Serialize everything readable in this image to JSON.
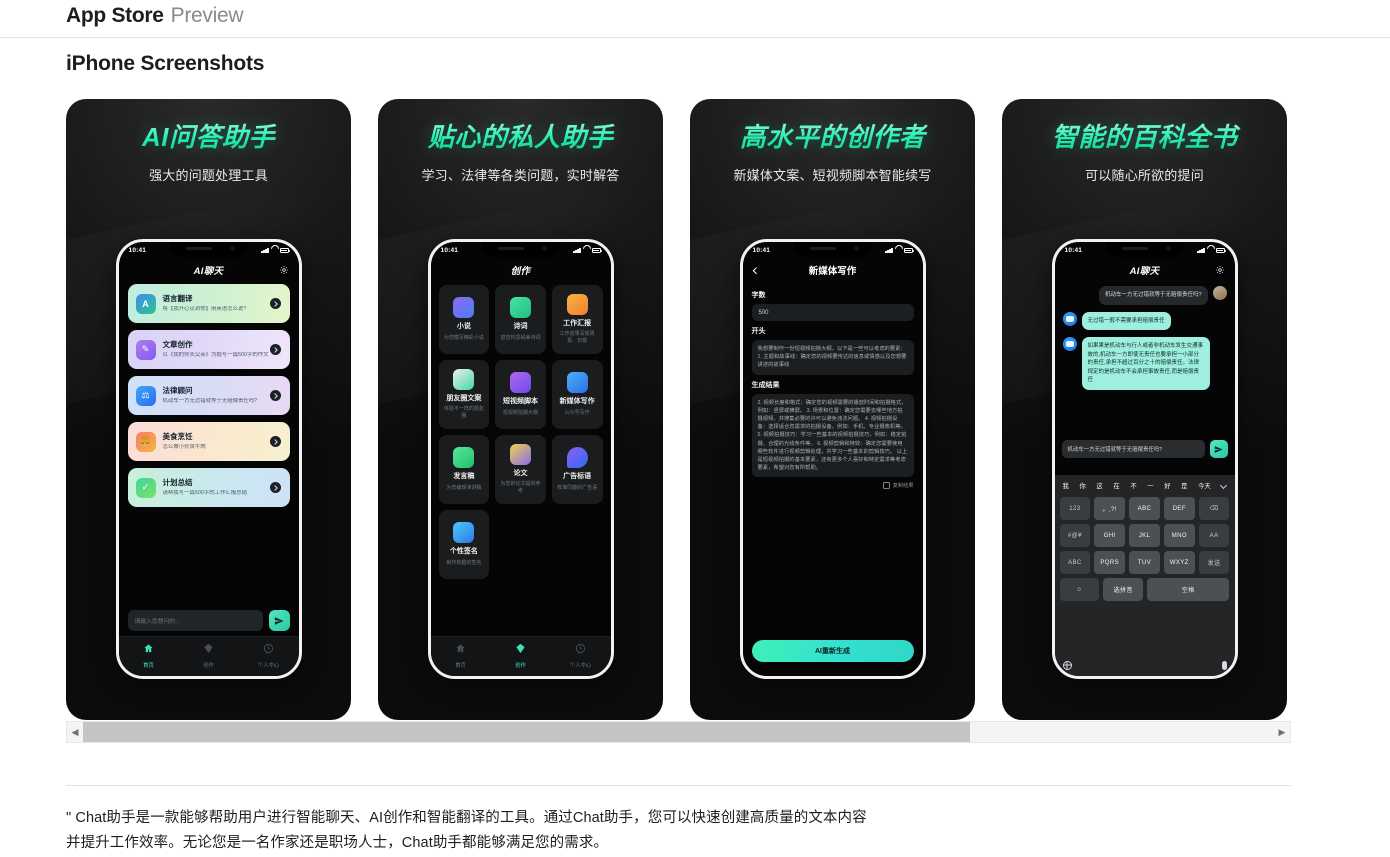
{
  "header": {
    "brand_bold": "App Store",
    "brand_light": "Preview"
  },
  "section": {
    "title": "iPhone Screenshots"
  },
  "scrollbar": {
    "left_arrow": "◀",
    "right_arrow": "▶",
    "thumb_percent": 74.5
  },
  "description": "\" Chat助手是一款能够帮助用户进行智能聊天、AI创作和智能翻译的工具。通过Chat助手，您可以快速创建高质量的文本内容并提升工作效率。无论您是一名作家还是职场人士，Chat助手都能够满足您的需求。",
  "colors": {
    "accent_green": "#2ff0b4",
    "bubble_bot": "#9fefe0",
    "panel_dark": "#1a1c1e",
    "page_bg": "#ffffff"
  },
  "status_bar": {
    "time": "10:41"
  },
  "shots": [
    {
      "title": "AI问答助手",
      "subtitle": "强大的问题处理工具",
      "nav_title": "AI聊天",
      "cards": [
        {
          "title": "语言翻译",
          "desc": "将【我开心见到你】用英语怎么说?"
        },
        {
          "title": "文章创作",
          "desc": "以《我的师长父亲》为题写一篇500字的作文"
        },
        {
          "title": "法律顾问",
          "desc": "机动车一方无过错就等于无赔偿责任吗?"
        },
        {
          "title": "美食烹饪",
          "desc": "怎么做小炒黄牛肉"
        },
        {
          "title": "计划总结",
          "desc": "请帮我写一篇500字的工作汇报总结"
        }
      ],
      "input_placeholder": "请输入您想问的...",
      "tabs": [
        {
          "label": "首页",
          "icon": "home-icon",
          "active": true
        },
        {
          "label": "创作",
          "icon": "create-icon",
          "active": false
        },
        {
          "label": "个人中心",
          "icon": "profile-icon",
          "active": false
        }
      ]
    },
    {
      "title": "贴心的私人助手",
      "subtitle": "学习、法律等各类问题，实时解答",
      "nav_title": "创作",
      "grid": [
        {
          "title": "小说",
          "desc": "为您模写精彩小说",
          "icon": "book-icon",
          "color": "#7b5cf0"
        },
        {
          "title": "诗词",
          "desc": "替您构思绢美诗词",
          "icon": "poem-icon",
          "color": "#2fc48a"
        },
        {
          "title": "工作汇报",
          "desc": "工作成果写成周报、日报",
          "icon": "report-icon",
          "color": "#f4a33f"
        },
        {
          "title": "朋友圈文案",
          "desc": "体验不一样的朋友圈",
          "icon": "moments-icon",
          "color": "#2fc48a"
        },
        {
          "title": "短视频脚本",
          "desc": "短视频拍摄大纲",
          "icon": "video-icon",
          "color": "#9b5cf0"
        },
        {
          "title": "新媒体写作",
          "desc": "公众号写作",
          "icon": "media-icon",
          "color": "#2f8cf0"
        },
        {
          "title": "发言稿",
          "desc": "为您编辑演讲稿",
          "icon": "speech-icon",
          "color": "#3fd68a"
        },
        {
          "title": "论文",
          "desc": "为您的论文提供参考",
          "icon": "thesis-icon",
          "color": "#7b5cf0"
        },
        {
          "title": "广告标语",
          "desc": "校准同趣的广告语",
          "icon": "ad-icon",
          "color": "#3f6df0"
        },
        {
          "title": "个性签名",
          "desc": "制作有趣的签名",
          "icon": "signature-icon",
          "color": "#2f9cf0"
        }
      ],
      "tabs": [
        {
          "label": "首页",
          "icon": "home-icon",
          "active": false
        },
        {
          "label": "创作",
          "icon": "create-icon",
          "active": true
        },
        {
          "label": "个人中心",
          "icon": "profile-icon",
          "active": false
        }
      ]
    },
    {
      "title": "高水平的创作者",
      "subtitle": "新媒体文案、短视频脚本智能续写",
      "nav_title": "新媒体写作",
      "form": {
        "word_count_label": "字数",
        "word_count_value": "500",
        "opening_label": "开头",
        "opening_text": "我想要制作一份短视频拍摄大纲，以下是一些可以考虑的要素：\n1. 主题和故事线：确定您的视频要传达的信息或情感以及您想要讲述的故事线",
        "result_label": "生成结果",
        "result_text": "2. 视频长度和格式：确定您的视频需要的播放时间和拍摄格式，例如：竖屏或横屏。\n3. 场景和位置：确定您需要去哪些地方拍摄视频，并搜集必要的许可以避免违法问题。\n4. 视频拍摄设备：选择适合您需求的拍摄设备，例如：手机、专业摄像机等。\n5. 视频拍摄技巧：学习一些基本的视频拍摄技巧，例如：稳定拍摄、合理的光线条件等。\n6. 视频剪辑和特效：确定您需要使用哪些软件进行视频剪辑处理，并学习一些基本的剪辑技巧。\n以上是短视频拍摄的基本要素，还有更多个人喜好和特定需求等考虑要素，希望对您有所帮助。",
        "copy_label": "复制结果",
        "regenerate_label": "AI重新生成"
      }
    },
    {
      "title": "智能的百科全书",
      "subtitle": "可以随心所欲的提问",
      "nav_title": "AI聊天",
      "messages": [
        {
          "from": "user",
          "text": "机动车一方无过错就等于无赔偿责任吗?"
        },
        {
          "from": "bot",
          "text": "无过错一般不需要承担赔偿责任"
        },
        {
          "from": "bot",
          "text": "如果果是机动车与行人或者非机动车发生交通事故的,机动车一方即使无责任也要承担一小部分的责任,承担不超过百分之十的赔偿责任。法律规定的是机动车不会承担事故责任,而是赔偿责任"
        }
      ],
      "chat_input_value": "机动车一方无过错就等于无赔偿责任吗?",
      "keyboard": {
        "suggestions": [
          "我",
          "你",
          "这",
          "在",
          "不",
          "一",
          "好",
          "是",
          "今天"
        ],
        "rows": [
          [
            "123",
            "。,?!",
            "ABC",
            "DEF",
            "⌫"
          ],
          [
            "#@¥",
            "GHI",
            "JKL",
            "MNO",
            "AA"
          ],
          [
            "ABC",
            "PQRS",
            "TUV",
            "WXYZ",
            "发送"
          ],
          [
            "☺",
            "选拼音",
            "空格"
          ]
        ],
        "globe_icon": "globe-icon",
        "mic_icon": "mic-icon"
      }
    }
  ]
}
